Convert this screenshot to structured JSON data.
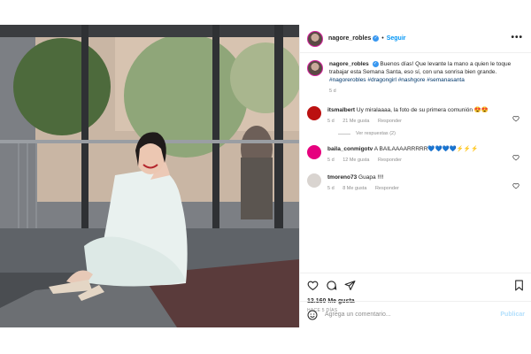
{
  "header": {
    "username": "nagore_robles",
    "follow_label": "Seguir",
    "more_label": "•••"
  },
  "caption": {
    "username": "nagore_robles",
    "text": "Buenos días! Que levante la mano a quien le toque trabajar esta Semana Santa, eso sí, con una sonrisa bien grande.",
    "hashtags": "#nagorerobles #dragongirl #nashgore #semanasanta",
    "age": "5 d"
  },
  "comments": [
    {
      "username": "itsmalbert",
      "text": "Uy miralaaaa, la foto de su primera comunión 😍😍",
      "age": "5 d",
      "likes": "21 Me gusta",
      "reply": "Responder",
      "view_replies": "Ver respuestas (2)"
    },
    {
      "username": "baila_conmigotv",
      "text": "A BAILAAAARRRRR💙💙💙💙⚡⚡⚡",
      "age": "5 d",
      "likes": "12 Me gusta",
      "reply": "Responder"
    },
    {
      "username": "tmoreno73",
      "text": "Guapa !!!!",
      "age": "5 d",
      "likes": "8 Me gusta",
      "reply": "Responder"
    }
  ],
  "footer": {
    "likes": "12.160 Me gusta",
    "ago": "HACE 5 DÍAS",
    "add_comment_placeholder": "Agrega un comentario...",
    "publish_label": "Publicar"
  },
  "colors": {
    "accent": "#0095f6",
    "muted": "#8e8e8e",
    "link": "#00376b"
  }
}
